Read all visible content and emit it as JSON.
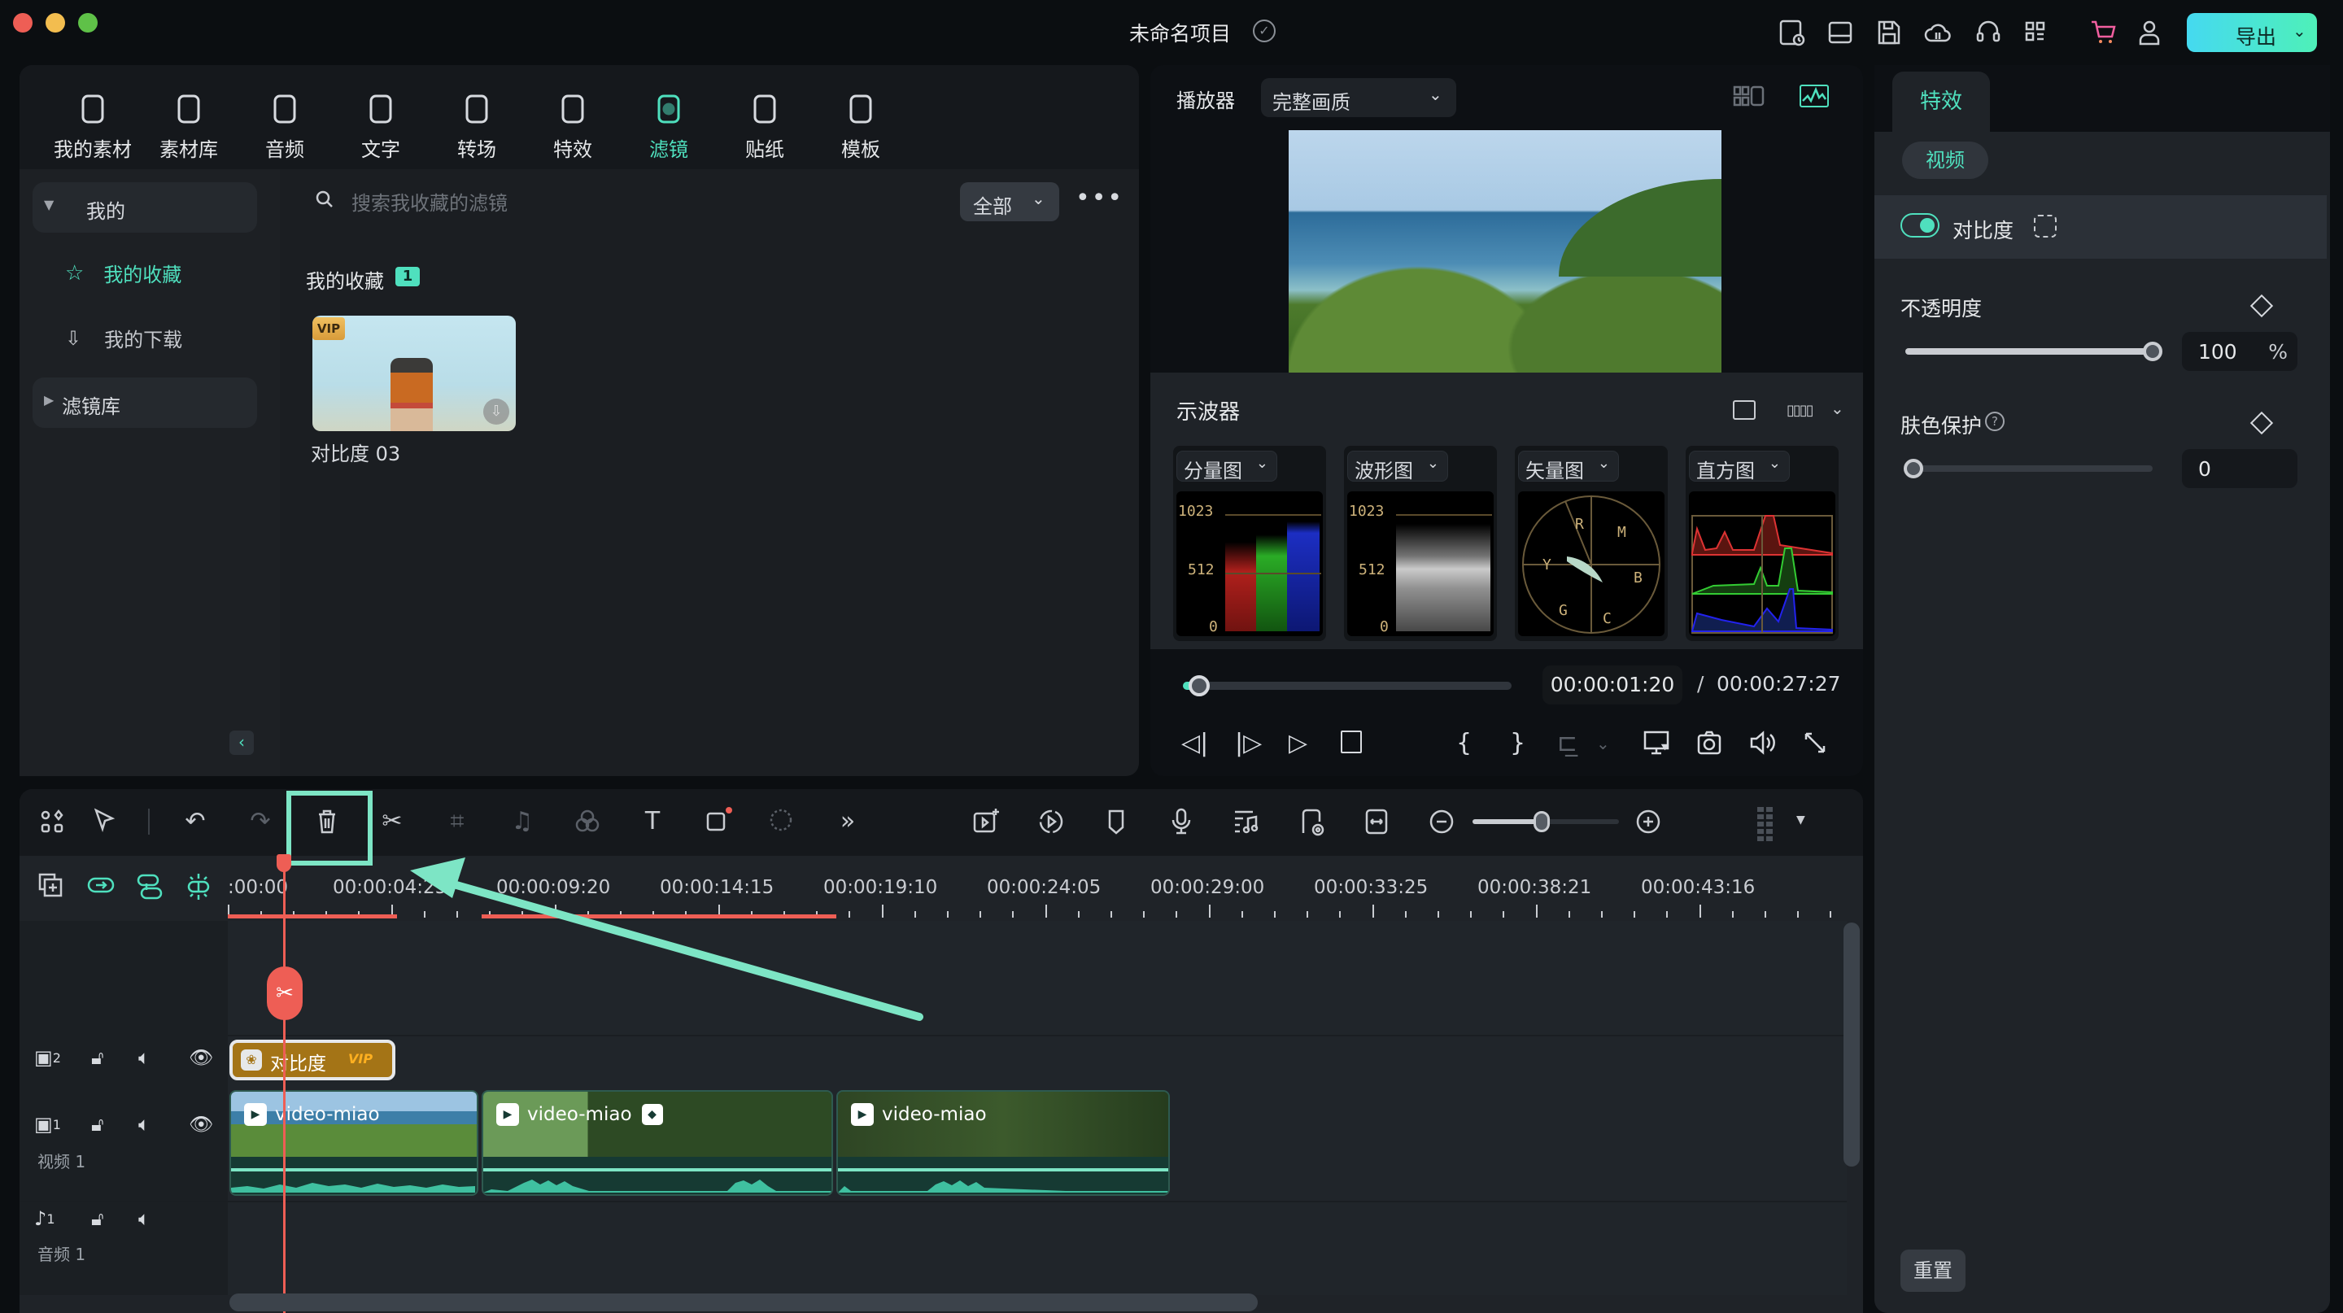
{
  "window": {
    "title": "未命名项目",
    "export_label": "导出",
    "top_icons": [
      "screen-record-icon",
      "layout-icon",
      "save-icon",
      "cloud-upload-icon",
      "headset-support-icon",
      "apps-grid-icon",
      "cart-icon",
      "user-icon"
    ]
  },
  "media_tabs": [
    {
      "label": "我的素材",
      "icon": "my-media-icon",
      "active": false
    },
    {
      "label": "素材库",
      "icon": "stock-library-icon",
      "active": false
    },
    {
      "label": "音频",
      "icon": "audio-icon",
      "active": false
    },
    {
      "label": "文字",
      "icon": "text-icon",
      "active": false
    },
    {
      "label": "转场",
      "icon": "transition-icon",
      "active": false
    },
    {
      "label": "特效",
      "icon": "effects-icon",
      "active": false
    },
    {
      "label": "滤镜",
      "icon": "filters-icon",
      "active": true
    },
    {
      "label": "贴纸",
      "icon": "sticker-icon",
      "active": false
    },
    {
      "label": "模板",
      "icon": "template-icon",
      "active": false
    }
  ],
  "sidebar": {
    "group_mine": "我的",
    "favorites": "我的收藏",
    "downloads": "我的下载",
    "group_library": "滤镜库"
  },
  "browser": {
    "search_placeholder": "搜索我收藏的滤镜",
    "filter_value": "全部",
    "more_label": "•••",
    "section_title": "我的收藏",
    "section_count": "1",
    "items": [
      {
        "label": "对比度 03",
        "badge": "VIP"
      }
    ]
  },
  "player": {
    "label": "播放器",
    "quality": "完整画质",
    "current_time": "00:00:01:20",
    "separator": "/",
    "total_time": "00:00:27:27",
    "progress_fraction": 0.05
  },
  "scopes": {
    "label": "示波器",
    "panels": [
      {
        "label": "分量图",
        "ticks": [
          "1023",
          "512",
          "0"
        ]
      },
      {
        "label": "波形图",
        "ticks": [
          "1023",
          "512",
          "0"
        ]
      },
      {
        "label": "矢量图",
        "ticks": [
          "R",
          "M",
          "Y",
          "B",
          "G",
          "C"
        ]
      },
      {
        "label": "直方图",
        "ticks": []
      }
    ]
  },
  "properties": {
    "tab": "特效",
    "chip": "视频",
    "effect_name": "对比度",
    "effect_enabled": true,
    "opacity_label": "不透明度",
    "opacity_value": "100",
    "opacity_unit": "%",
    "opacity_fraction": 1.0,
    "skin_label": "肤色保护",
    "skin_value": "0",
    "skin_fraction": 0.0,
    "reset_label": "重置"
  },
  "timeline": {
    "toolbar_left": [
      "scene-detect-icon",
      "select-tool-icon",
      "undo-icon",
      "redo-icon",
      "delete-icon",
      "split-icon",
      "crop-icon",
      "audio-edit-icon",
      "color-icon",
      "text-tool-icon",
      "shape-record-icon",
      "mask-tool-icon",
      "more-tools-icon"
    ],
    "toolbar_right": [
      "ai-video-icon",
      "speed-icon",
      "marker-icon",
      "voiceover-icon",
      "audio-beat-icon",
      "render-preview-icon",
      "fit-icon",
      "zoom-out-icon",
      "zoom-in-icon",
      "grid-menu-icon"
    ],
    "zoom_fraction": 0.47,
    "ruler_labels": [
      ":00:00",
      "00:00:04:25",
      "00:00:09:20",
      "00:00:14:15",
      "00:00:19:10",
      "00:00:24:05",
      "00:00:29:00",
      "00:00:33:25",
      "00:00:38:21",
      "00:00:43:16"
    ],
    "tracks": {
      "video2": {
        "index": "2"
      },
      "video1": {
        "index": "1",
        "label": "视频 1"
      },
      "audio1": {
        "index": "1",
        "label": "音频 1"
      }
    },
    "fx_clip": {
      "label": "对比度",
      "badge": "VIP"
    },
    "video_clips": [
      {
        "label": "video-miao"
      },
      {
        "label": "video-miao"
      },
      {
        "label": "video-miao"
      }
    ]
  },
  "colors": {
    "accent": "#4fe0be",
    "playhead": "#ee5e55",
    "annotation": "#7de5c5",
    "fx_clip": "#a47416"
  }
}
